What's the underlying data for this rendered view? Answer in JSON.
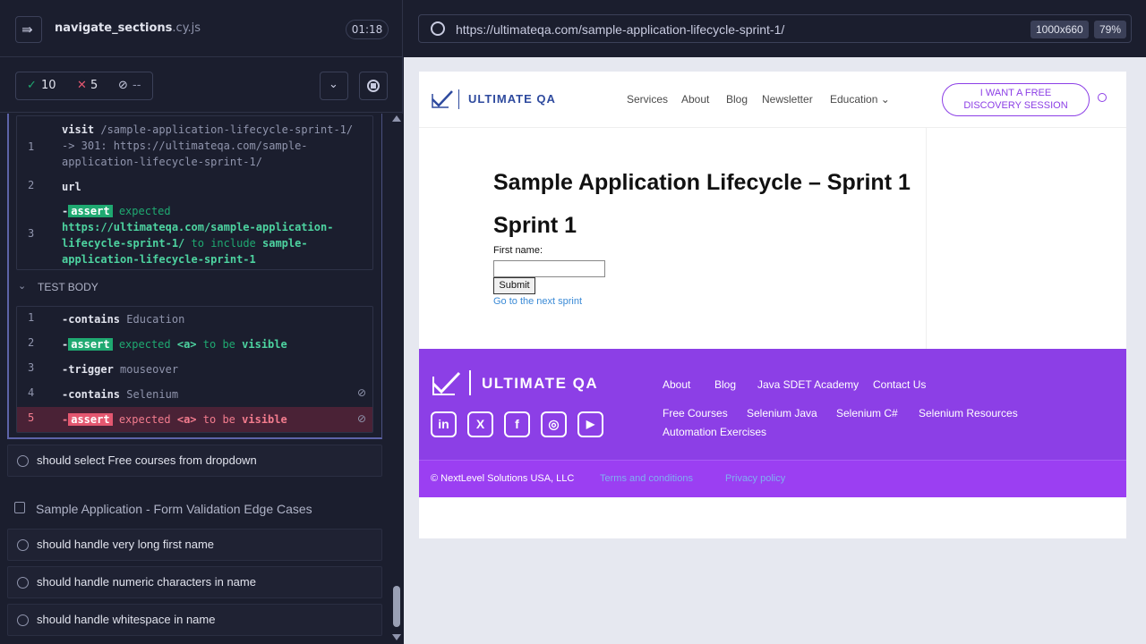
{
  "runner": {
    "spec_name": "navigate_sections",
    "spec_ext": ".cy.js",
    "timer": "01:18",
    "passed": "10",
    "failed": "5",
    "pending": "--",
    "pass_icon": "✓",
    "fail_icon": "✕",
    "pending_icon": "⊘"
  },
  "before_commands": [
    {
      "num": "1",
      "name": "visit",
      "arg": "/sample-application-lifecycle-sprint-1/ -> 301: https://ultimateqa.com/sample-application-lifecycle-sprint-1/"
    },
    {
      "num": "2",
      "name": "url"
    },
    {
      "num": "3",
      "prefix": "-",
      "badge": "assert",
      "word1": "expected",
      "value": "https://ultimateqa.com/sample-application-lifecycle-sprint-1/",
      "word2": "to include",
      "value2": "sample-application-lifecycle-sprint-1"
    }
  ],
  "test_body": {
    "label": "TEST BODY",
    "commands": [
      {
        "num": "1",
        "name": "-contains",
        "arg": "Education"
      },
      {
        "num": "2",
        "prefix": "-",
        "badge": "assert",
        "w1": "expected",
        "w2": "<a>",
        "w3": "to be",
        "w4": "visible"
      },
      {
        "num": "3",
        "name": "-trigger",
        "arg": "mouseover"
      },
      {
        "num": "4",
        "name": "-contains",
        "arg": "Selenium"
      },
      {
        "num": "5",
        "prefix": "-",
        "badge": "assert",
        "w1": "expected",
        "w2": "<a>",
        "w3": "to be",
        "w4": "visible"
      }
    ]
  },
  "tests": [
    {
      "label": "should select Free courses from dropdown"
    }
  ],
  "suite": {
    "title": "Sample Application - Form Validation Edge Cases",
    "tests": [
      {
        "label": "should handle very long first name"
      },
      {
        "label": "should handle numeric characters in name"
      },
      {
        "label": "should handle whitespace in name"
      }
    ]
  },
  "browser": {
    "url": "https://ultimateqa.com/sample-application-lifecycle-sprint-1/",
    "viewport": "1000x660",
    "zoom": "79%"
  },
  "site": {
    "logo_text": "ULTIMATE QA",
    "nav": [
      "Services",
      "About",
      "Blog",
      "Newsletter",
      "Education"
    ],
    "cta_line1": "I WANT A FREE",
    "cta_line2": "DISCOVERY SESSION",
    "page_title": "Sample Application Lifecycle – Sprint 1",
    "heading": "Sprint 1",
    "first_name_label": "First name:",
    "submit_label": "Submit",
    "next_link": "Go to the next sprint",
    "footer_links_row1": [
      "About",
      "Blog",
      "Java SDET Academy",
      "Contact Us"
    ],
    "footer_links_row2": [
      "Free Courses",
      "Selenium Java",
      "Selenium C#",
      "Selenium Resources"
    ],
    "footer_links_row3": [
      "Automation Exercises"
    ],
    "social": [
      "in",
      "X",
      "f",
      "◎",
      "▶"
    ],
    "copyright": "© NextLevel Solutions USA, LLC",
    "terms": "Terms and conditions",
    "privacy": "Privacy policy",
    "footer_color": "#8c3fe6",
    "brand_color": "#2e4a9e"
  }
}
